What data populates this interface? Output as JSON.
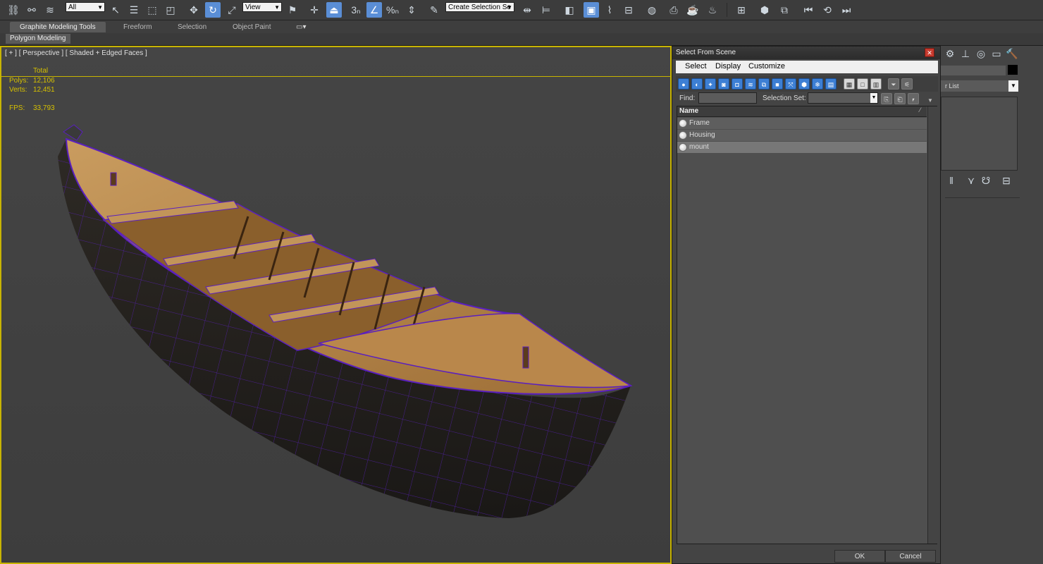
{
  "toolbar": {
    "selection_filter": "All",
    "reference_coord": "View",
    "create_selection_set": "Create Selection Se",
    "snap_angle_label": "3",
    "percent_snap_label": "%"
  },
  "ribbon": {
    "tabs": [
      "Graphite Modeling Tools",
      "Freeform",
      "Selection",
      "Object Paint"
    ],
    "sub_label": "Polygon Modeling"
  },
  "viewport": {
    "label": "[ + ] [ Perspective ] [ Shaded + Edged Faces ]",
    "stats": {
      "total_header": "Total",
      "polys_label": "Polys:",
      "polys_value": "12,106",
      "verts_label": "Verts:",
      "verts_value": "12,451",
      "fps_label": "FPS:",
      "fps_value": "33,793"
    }
  },
  "dialog": {
    "title": "Select From Scene",
    "close_glyph": "✕",
    "menus": [
      "Select",
      "Display",
      "Customize"
    ],
    "find_label": "Find:",
    "selection_set_label": "Selection Set:",
    "column_name": "Name",
    "objects": [
      "Frame",
      "Housing",
      "mount"
    ],
    "ok_label": "OK",
    "cancel_label": "Cancel"
  },
  "cmdpanel": {
    "modifier_list": "r List"
  },
  "colors": {
    "accent": "#5a8ed6",
    "viewport_border": "#c8b400",
    "stat_text": "#d6c000",
    "wireframe": "#5a1fbf"
  }
}
